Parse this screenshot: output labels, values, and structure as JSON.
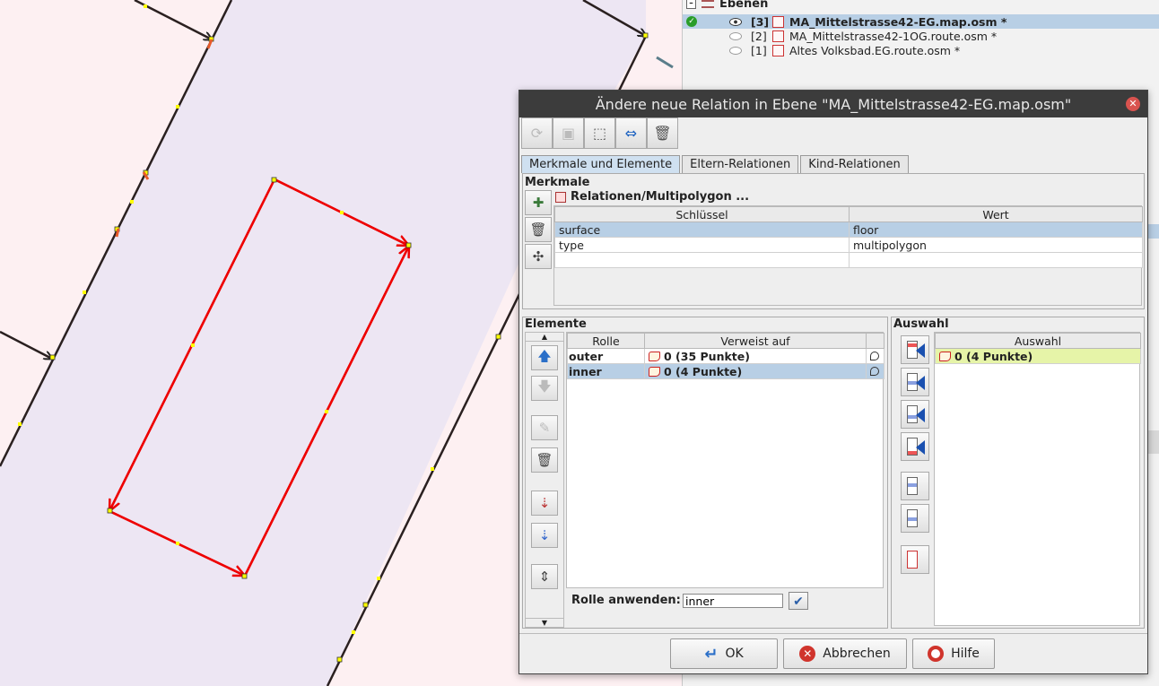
{
  "layers": {
    "title": "Ebenen",
    "items": [
      {
        "num": "[3]",
        "name": "MA_Mittelstrasse42-EG.map.osm *",
        "active": true,
        "visible": true
      },
      {
        "num": "[2]",
        "name": "MA_Mittelstrasse42-1OG.route.osm *",
        "active": false,
        "visible": false
      },
      {
        "num": "[1]",
        "name": "Altes Volksbad.EG.route.osm *",
        "active": false,
        "visible": false
      }
    ]
  },
  "dialog": {
    "title": "Ändere neue Relation in Ebene \"MA_Mittelstrasse42-EG.map.osm\"",
    "close_glyph": "✕",
    "toolbar": {
      "refresh": "⟳",
      "save": "▣",
      "select": "⬚",
      "zoom": "⇔",
      "delete": "🗑"
    },
    "tabs": [
      "Merkmale und Elemente",
      "Eltern-Relationen",
      "Kind-Relationen"
    ],
    "tags": {
      "section": "Merkmale",
      "preset": "Relationen/Multipolygon ...",
      "col_key": "Schlüssel",
      "col_value": "Wert",
      "rows": [
        {
          "key": "surface",
          "value": "floor"
        },
        {
          "key": "type",
          "value": "multipolygon"
        },
        {
          "key": "",
          "value": ""
        }
      ],
      "btn_add": "✚",
      "btn_delete": "🗑",
      "btn_paste": "✣"
    },
    "members": {
      "section": "Elemente",
      "col_role": "Rolle",
      "col_ref": "Verweist auf",
      "rows": [
        {
          "role": "outer",
          "ref": "0 (35 Punkte)"
        },
        {
          "role": "inner",
          "ref": "0 (4 Punkte)"
        }
      ],
      "apply_label": "Rolle anwenden:",
      "apply_value": "inner",
      "apply_check": "✔",
      "btn_up": "🡅",
      "btn_down": "🡇",
      "btn_edit": "✎",
      "btn_del": "🗑",
      "btn_sort": "⇣",
      "btn_sort2": "⇣",
      "btn_reverse": "⇕",
      "scroll_up": "▲",
      "scroll_down": "▼"
    },
    "selection": {
      "section": "Auswahl",
      "col": "Auswahl",
      "rows": [
        {
          "ref": "0 (4 Punkte)"
        }
      ]
    },
    "buttons": {
      "ok": "OK",
      "cancel": "Abbrechen",
      "help": "Hilfe",
      "ok_icon": "↵",
      "cancel_icon": "✕"
    }
  }
}
